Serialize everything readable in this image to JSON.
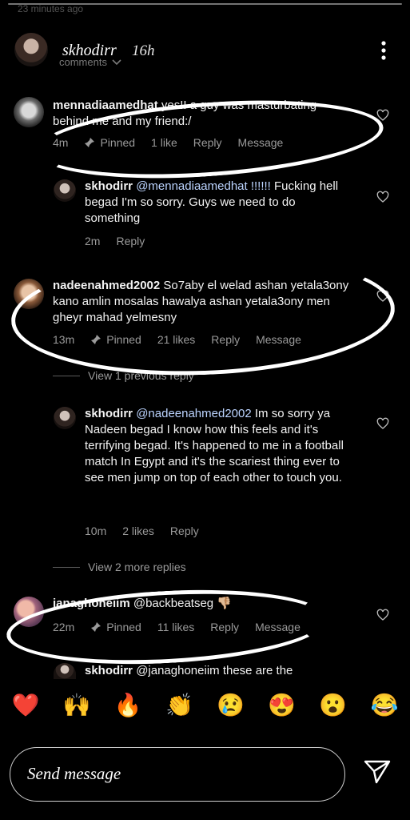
{
  "story": {
    "progress_time": "23 minutes ago",
    "username": "skhodirr",
    "posted": "16h",
    "comments_label": "comments"
  },
  "comments": [
    {
      "username": "mennadiaamedhat",
      "text": "yes!! a guy was masturbating behind me and my friend:/",
      "time": "4m",
      "pinned": "Pinned",
      "likes": "1 like",
      "reply": "Reply",
      "message": "Message"
    },
    {
      "username": "skhodirr",
      "mention": "@mennadiaamedhat !!!!!!",
      "text": "Fucking hell begad I'm so sorry. Guys we need to do something",
      "time": "2m",
      "reply": "Reply"
    },
    {
      "username": "nadeenahmed2002",
      "text": "So7aby el welad ashan yetala3ony kano amlin mosalas hawalya ashan yetala3ony men gheyr mahad yelmesny",
      "time": "13m",
      "pinned": "Pinned",
      "likes": "21 likes",
      "reply": "Reply",
      "message": "Message",
      "view_previous": "View 1 previous reply"
    },
    {
      "username": "skhodirr",
      "mention": "@nadeenahmed2002",
      "text": "Im so sorry ya Nadeen begad I know how this feels and it's terrifying begad. It's happened to me in a football match In Egypt and it's the scariest thing ever to see men jump on top of each other to touch you.",
      "time": "10m",
      "likes": "2 likes",
      "reply": "Reply",
      "view_more": "View 2 more replies"
    },
    {
      "username": "janaghoneiim",
      "mention": "@backbeatseg",
      "emoji": "👎🏼",
      "time": "22m",
      "pinned": "Pinned",
      "likes": "11 likes",
      "reply": "Reply",
      "message": "Message"
    },
    {
      "username": "skhodirr",
      "mention": "@janaghoneiim",
      "text": "these are the"
    }
  ],
  "emoji_bar": [
    "❤️",
    "🙌",
    "🔥",
    "👏",
    "😢",
    "😍",
    "😮",
    "😂"
  ],
  "message_input": {
    "placeholder": "Send message"
  },
  "icons": {
    "send": "send-icon",
    "more": "more-options-icon",
    "heart": "heart-outline-icon",
    "pin": "pin-icon",
    "chevron": "chevron-down-icon"
  }
}
